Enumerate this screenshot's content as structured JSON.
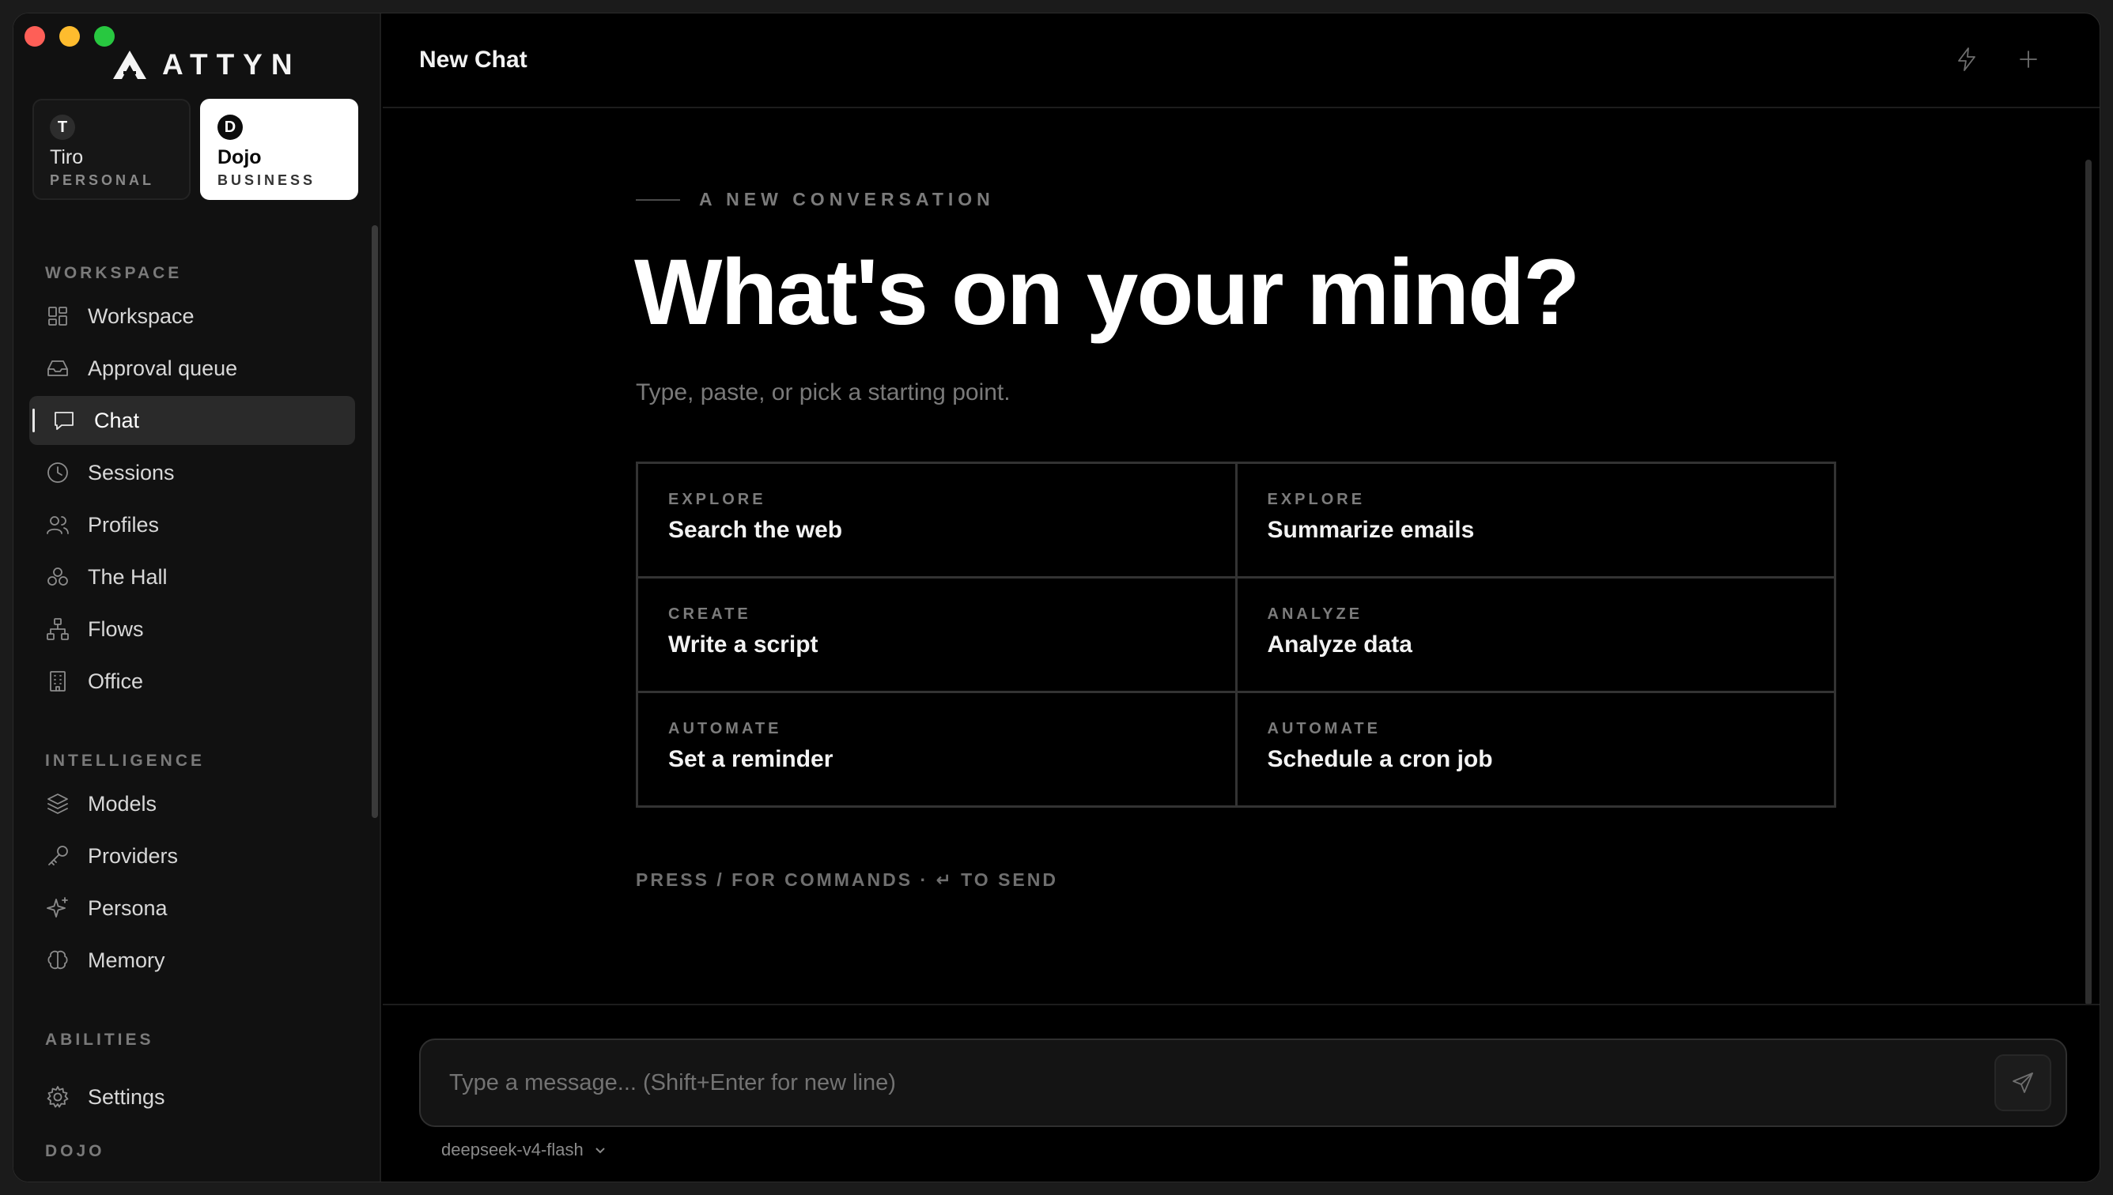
{
  "brand": {
    "name": "ATTYN"
  },
  "accounts": [
    {
      "initial": "T",
      "name": "Tiro",
      "type": "PERSONAL",
      "active": false
    },
    {
      "initial": "D",
      "name": "Dojo",
      "type": "BUSINESS",
      "active": true
    }
  ],
  "sidebar": {
    "sections": {
      "workspace": "WORKSPACE",
      "intelligence": "INTELLIGENCE",
      "abilities": "ABILITIES",
      "dojo": "DOJO"
    },
    "items": [
      {
        "label": "Workspace",
        "icon": "grid-icon"
      },
      {
        "label": "Approval queue",
        "icon": "inbox-icon"
      },
      {
        "label": "Chat",
        "icon": "chat-icon",
        "active": true
      },
      {
        "label": "Sessions",
        "icon": "clock-icon"
      },
      {
        "label": "Profiles",
        "icon": "users-icon"
      },
      {
        "label": "The Hall",
        "icon": "hall-icon"
      },
      {
        "label": "Flows",
        "icon": "flows-icon"
      },
      {
        "label": "Office",
        "icon": "building-icon"
      },
      {
        "label": "Models",
        "icon": "layers-icon"
      },
      {
        "label": "Providers",
        "icon": "key-icon"
      },
      {
        "label": "Persona",
        "icon": "sparkle-icon"
      },
      {
        "label": "Memory",
        "icon": "brain-icon"
      },
      {
        "label": "Settings",
        "icon": "gear-icon"
      }
    ]
  },
  "header": {
    "title": "New Chat"
  },
  "hero": {
    "kicker": "A NEW CONVERSATION",
    "headline": "What's on your mind?",
    "subline": "Type, paste, or pick a starting point."
  },
  "suggestions": [
    {
      "category": "EXPLORE",
      "title": "Search the web"
    },
    {
      "category": "EXPLORE",
      "title": "Summarize emails"
    },
    {
      "category": "CREATE",
      "title": "Write a script"
    },
    {
      "category": "ANALYZE",
      "title": "Analyze data"
    },
    {
      "category": "AUTOMATE",
      "title": "Set a reminder"
    },
    {
      "category": "AUTOMATE",
      "title": "Schedule a cron job"
    }
  ],
  "hint": "PRESS / FOR COMMANDS · ↵ TO SEND",
  "composer": {
    "placeholder": "Type a message... (Shift+Enter for new line)",
    "model": "deepseek-v4-flash"
  },
  "colors": {
    "background": "#000000",
    "sidebar": "#111111",
    "active_account": "#ffffff"
  }
}
